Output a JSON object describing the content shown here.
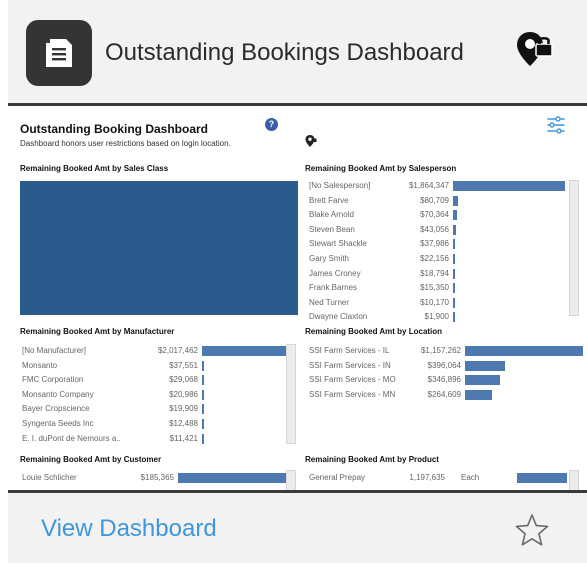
{
  "card": {
    "title": "Outstanding Bookings Dashboard",
    "view_link": "View Dashboard"
  },
  "dashboard": {
    "title": "Outstanding Booking Dashboard",
    "subtitle": "Dashboard honors user restrictions based on login location.",
    "help_glyph": "?",
    "panels": {
      "sales_class": {
        "title": "Remaining Booked Amt by Sales Class"
      },
      "salesperson": {
        "title": "Remaining Booked Amt by Salesperson",
        "rows": [
          {
            "label": "[No Salesperson]",
            "value": "$1,864,347",
            "amount": 1864347
          },
          {
            "label": "Brett Farve",
            "value": "$80,709",
            "amount": 80709
          },
          {
            "label": "Blake Arnold",
            "value": "$70,364",
            "amount": 70364
          },
          {
            "label": "Steven Bean",
            "value": "$43,056",
            "amount": 43056
          },
          {
            "label": "Stewart Shackle",
            "value": "$37,986",
            "amount": 37986
          },
          {
            "label": "Gary Smith",
            "value": "$22,156",
            "amount": 22156
          },
          {
            "label": "James Croney",
            "value": "$18,794",
            "amount": 18794
          },
          {
            "label": "Frank Barnes",
            "value": "$15,350",
            "amount": 15350
          },
          {
            "label": "Ned Turner",
            "value": "$10,170",
            "amount": 10170
          },
          {
            "label": "Dwayne Claxton",
            "value": "$1,900",
            "amount": 1900
          }
        ]
      },
      "manufacturer": {
        "title": "Remaining Booked Amt by Manufacturer",
        "rows": [
          {
            "label": "[No Manufacturer]",
            "value": "$2,017,462",
            "amount": 2017462
          },
          {
            "label": "Monsanto",
            "value": "$37,551",
            "amount": 37551
          },
          {
            "label": "FMC Corporation",
            "value": "$29,068",
            "amount": 29068
          },
          {
            "label": "Monsanto Company",
            "value": "$20,986",
            "amount": 20986
          },
          {
            "label": "Bayer Cropscience",
            "value": "$19,909",
            "amount": 19909
          },
          {
            "label": "Syngenta Seeds Inc",
            "value": "$12,488",
            "amount": 12488
          },
          {
            "label": "E. I. duPont de Nemours a..",
            "value": "$11,421",
            "amount": 11421
          }
        ]
      },
      "location": {
        "title": "Remaining Booked Amt by Location",
        "rows": [
          {
            "label": "SSI Farm Services - IL",
            "value": "$1,157,262",
            "amount": 1157262
          },
          {
            "label": "SSI Farm Services - IN",
            "value": "$396,064",
            "amount": 396064
          },
          {
            "label": "SSI Farm Services - MO",
            "value": "$346,896",
            "amount": 346896
          },
          {
            "label": "SSI Farm Services - MN",
            "value": "$264,609",
            "amount": 264609
          }
        ]
      },
      "customer": {
        "title": "Remaining Booked Amt by Customer",
        "rows": [
          {
            "label": "Louie Schlicher",
            "value": "$185,365",
            "amount": 185365
          }
        ]
      },
      "product": {
        "title": "Remaining Booked Amt by Product",
        "rows": [
          {
            "label": "General Prepay",
            "value": "1,197,635",
            "unit": "Each",
            "amount": 1197635
          }
        ]
      }
    }
  },
  "colors": {
    "accent": "#3e97dd",
    "bar": "#4e79b0",
    "block": "#2b5a8c",
    "badge": "#343434"
  }
}
